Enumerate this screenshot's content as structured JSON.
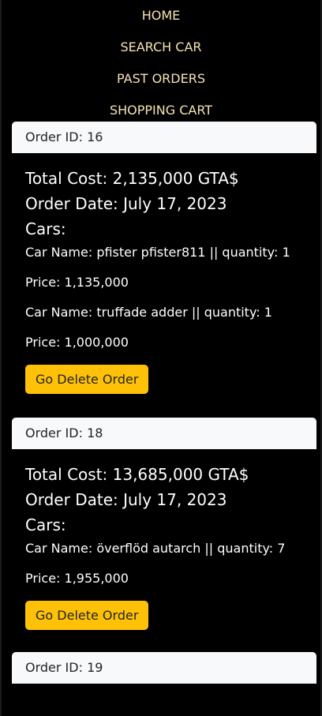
{
  "nav": {
    "items": [
      {
        "label": "HOME"
      },
      {
        "label": "SEARCH CAR"
      },
      {
        "label": "PAST ORDERS"
      },
      {
        "label": "SHOPPING CART"
      }
    ]
  },
  "orders": [
    {
      "header": "Order ID: 16",
      "total_cost": "Total Cost: 2,135,000 GTA$",
      "order_date": "Order Date: July 17, 2023",
      "cars_title": "Cars:",
      "cars": [
        {
          "name_qty": "Car Name: pfister pfister811 || quantity: 1",
          "price": "Price: 1,135,000"
        },
        {
          "name_qty": "Car Name: truffade adder || quantity: 1",
          "price": "Price: 1,000,000"
        }
      ],
      "delete_label": "Go Delete Order"
    },
    {
      "header": "Order ID: 18",
      "total_cost": "Total Cost: 13,685,000 GTA$",
      "order_date": "Order Date: July 17, 2023",
      "cars_title": "Cars:",
      "cars": [
        {
          "name_qty": "Car Name: överflöd autarch || quantity: 7",
          "price": "Price: 1,955,000"
        }
      ],
      "delete_label": "Go Delete Order"
    },
    {
      "header": "Order ID: 19"
    }
  ],
  "colors": {
    "background": "#000000",
    "nav_link": "#f6e3b4",
    "card_header_bg": "#f8f9fa",
    "button_bg": "#ffc107",
    "button_text": "#212529"
  }
}
